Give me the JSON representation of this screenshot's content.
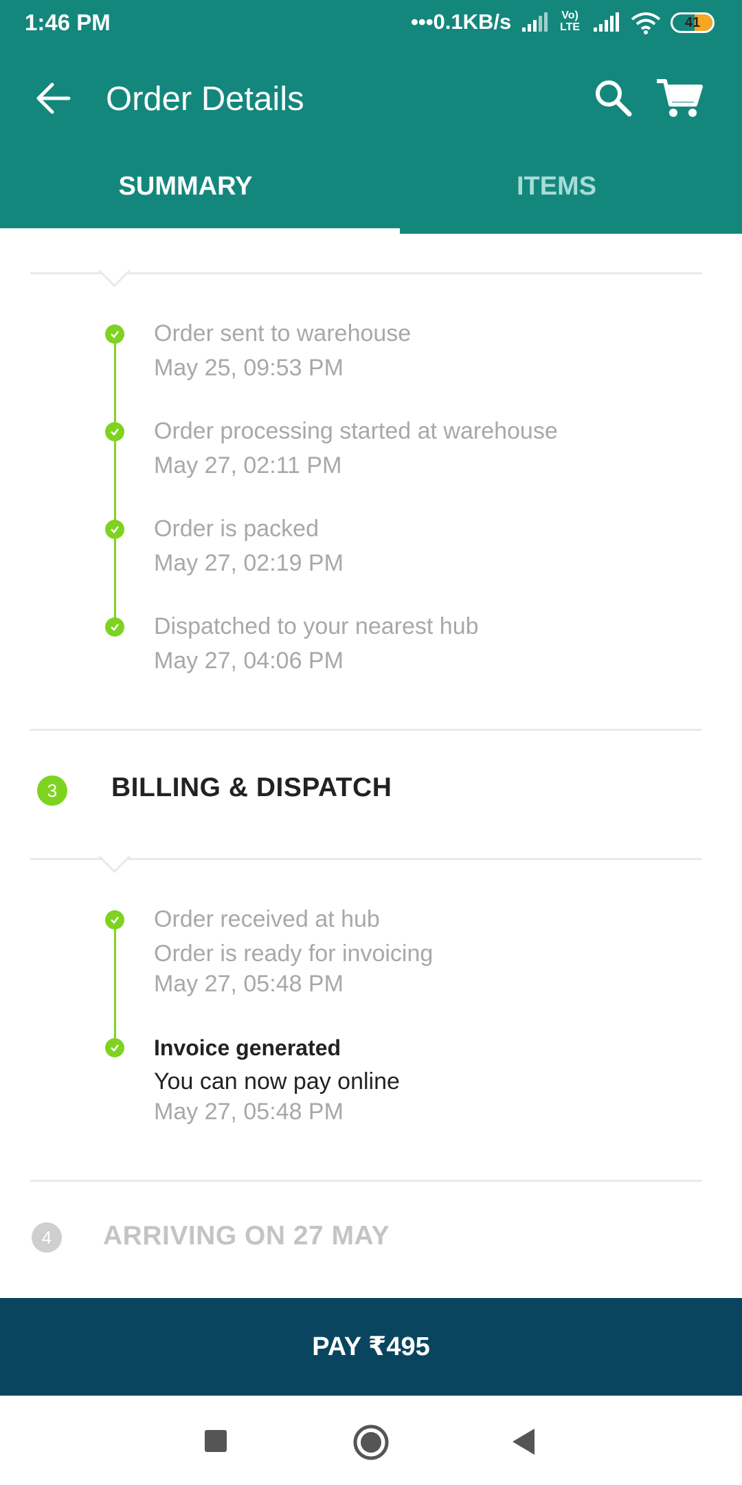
{
  "status_bar": {
    "time": "1:46 PM",
    "network_speed": "•••0.1KB/s",
    "lte_label": "Vo) LTE",
    "battery": "41"
  },
  "app_bar": {
    "title": "Order Details",
    "icons": [
      "back-arrow-icon",
      "search-icon",
      "cart-icon"
    ]
  },
  "tabs": [
    {
      "label": "SUMMARY",
      "active": true
    },
    {
      "label": "ITEMS",
      "active": false
    }
  ],
  "shipping_events": [
    {
      "title": "Order sent to warehouse",
      "time": "May 25, 09:53 PM"
    },
    {
      "title": "Order processing started at warehouse",
      "time": "May 27, 02:11 PM"
    },
    {
      "title": "Order is packed",
      "time": "May 27, 02:19 PM"
    },
    {
      "title": "Dispatched to your nearest hub",
      "time": "May 27, 04:06 PM"
    }
  ],
  "billing_step": {
    "number": "3",
    "title": "BILLING & DISPATCH",
    "events": [
      {
        "title": "Order received at hub",
        "subtitle": "Order is ready for invoicing",
        "time": "May 27, 05:48 PM"
      },
      {
        "title": "Invoice generated",
        "subtitle": "You can now pay online",
        "time": "May 27, 05:48 PM"
      }
    ]
  },
  "arriving_step": {
    "number": "4",
    "title": "ARRIVING ON 27 MAY"
  },
  "pay_button": {
    "label": "PAY ₹495"
  },
  "colors": {
    "header": "#14877d",
    "accent_green": "#7ed321",
    "pay_bar": "#0a4560"
  }
}
